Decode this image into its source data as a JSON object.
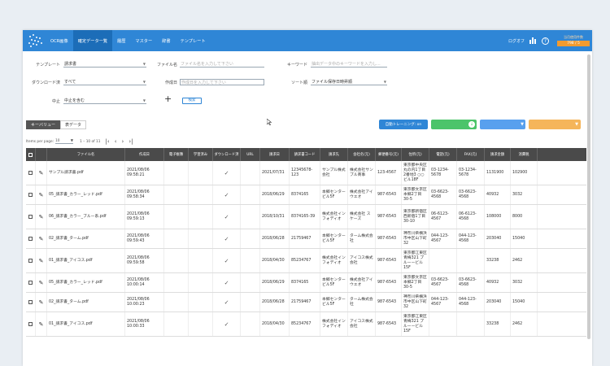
{
  "nav": {
    "items": [
      "OCR画像",
      "確定データ一覧",
      "履歴",
      "マスター",
      "辞書",
      "テンプレート"
    ],
    "logout": "ログオフ",
    "usage_label": "当月使用件数",
    "usage_value": "798 / 5"
  },
  "filters": {
    "template_label": "テンプレート",
    "template_value": "請求書",
    "filename_label": "ファイル名",
    "filename_placeholder": "ファイル名を入力して下さい",
    "keyword_label": "キーワード",
    "keyword_placeholder": "抽出データ中のキーワードを入力し...",
    "download_label": "ダウンロード済",
    "download_value": "すべて",
    "creator_label": "作成日",
    "creator_placeholder": "作成日を入力して下さい",
    "sort_label": "ソート順",
    "sort_value": "ファイル保存日時昇順",
    "stop_label": "中止",
    "stop_value": "中止を含む",
    "plus": "+",
    "search_button": "検索"
  },
  "tabs": [
    "キーバリュー",
    "表データ"
  ],
  "buttons": {
    "auto_training": "自動トレーニング: on",
    "btn2": "",
    "btn3": "",
    "btn4": ""
  },
  "pager": {
    "items_per_page_label": "Items per page:",
    "items_per_page_value": "10",
    "range": "1 – 10 of 11",
    "first": "|‹",
    "prev": "‹",
    "next": "›",
    "last": "›|"
  },
  "table": {
    "headers": [
      "",
      "",
      "ファイル名",
      "作成日",
      "電子帳簿",
      "学習済み",
      "ダウンロード済",
      "URL",
      "請求日",
      "請求書コード",
      "請求先",
      "会社名(元)",
      "郵便番号(元)",
      "住所(元)",
      "電話(元)",
      "FAX(元)",
      "請求金額",
      "消費税"
    ],
    "rows": [
      [
        "サンプル請求書.pdf",
        "2021/08/06 09:58:21",
        "2021/07/31",
        "12345678-123",
        "サンプル株式会社",
        "株式会社サンプル商事",
        "123-4567",
        "東京都中央区丸の内1丁目2番地3 ○○ビル18F",
        "03-1234-5678",
        "03-1234-5678",
        "1131900",
        "102900"
      ],
      [
        "05_請求書_カラー_レッド.pdf",
        "2021/08/06 09:58:34",
        "2018/06/29",
        "8374165",
        "本郷センタービル5F",
        "株式会社アイウエオ",
        "987-6543",
        "東京都文京区本郷2丁目30-5",
        "03-6623-4568",
        "03-6623-4568",
        "40932",
        "3032"
      ],
      [
        "06_請求書_カラー_ブルー系.pdf",
        "2021/08/06 09:59:13",
        "2018/10/31",
        "8374165-39",
        "株式会社インフォディオ",
        "株式会社 スケーズ",
        "987-6543",
        "東京都新宿区西新宿1丁目30-10",
        "06-6123-4567",
        "06-6123-4568",
        "108000",
        "8000"
      ],
      [
        "02_請求書_ターム.pdf",
        "2021/08/06 09:59:43",
        "2018/06/28",
        "21759467",
        "本郷センタービル5F",
        "ターム株式会社",
        "987-6543",
        "神奈川県横浜市中区山下町32",
        "044-123-4567",
        "044-123-4568",
        "203040",
        "15040"
      ],
      [
        "01_請求書_アイコス.pdf",
        "2021/08/06 09:59:58",
        "2018/04/30",
        "85234767",
        "株式会社インフォディオ",
        "アイコス株式会社",
        "987-6543",
        "東京都江東区青梅321 プルーービル15F",
        "",
        "",
        "33238",
        "2462"
      ],
      [
        "05_請求書_カラー_レッド.pdf",
        "2021/08/06 10:00:14",
        "2018/06/29",
        "8374165",
        "本郷センタービル5F",
        "株式会社アイウエオ",
        "987-6543",
        "東京都文京区本郷2丁目30-5",
        "03-6623-4567",
        "03-6623-4568",
        "40932",
        "3032"
      ],
      [
        "02_請求書_ターム.pdf",
        "2021/08/06 10:00:23",
        "2018/06/28",
        "21759467",
        "本郷センタービル5F",
        "ターム株式会社",
        "987-6543",
        "神奈川県横浜市中区山下町32",
        "044-123-4567",
        "044-123-4568",
        "203040",
        "15040"
      ],
      [
        "01_請求書_アイコス.pdf",
        "2021/08/06 10:00:33",
        "2018/04/30",
        "85234767",
        "株式会社インフォディオ",
        "アイコス株式会社",
        "987-6543",
        "東京都江東区青梅321 プルーービル15F",
        "",
        "",
        "33238",
        "2462"
      ]
    ]
  },
  "colors": {
    "nav": "#2f86d6",
    "auto_training": "#2f86d6",
    "green": "#4cc46a",
    "blue": "#58a0ee",
    "orange": "#f5b55a"
  }
}
